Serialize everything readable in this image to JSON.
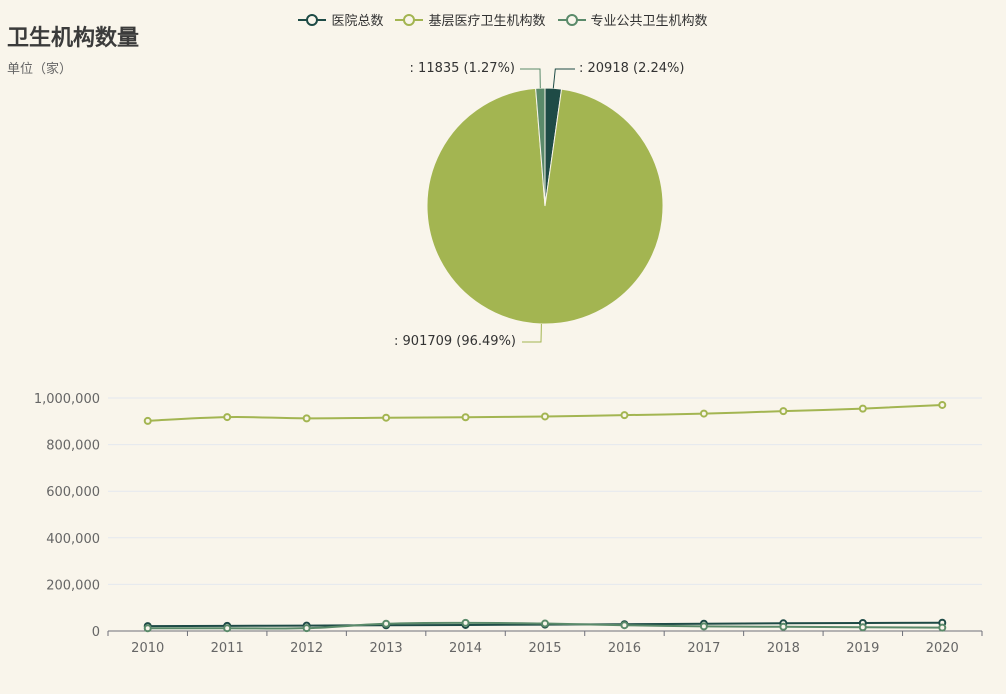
{
  "title": "卫生机构数量",
  "subtitle": "单位（家）",
  "legend": [
    {
      "name": "医院总数",
      "color": "#1e4b46"
    },
    {
      "name": "基层医疗卫生机构数",
      "color": "#a3b551"
    },
    {
      "name": "专业公共卫生机构数",
      "color": "#5a8a6a"
    }
  ],
  "chart_data": [
    {
      "type": "pie",
      "slices": [
        {
          "name": "医院总数",
          "value": 20918,
          "percent": 2.24,
          "label": ": 20918 (2.24%)",
          "color": "#1e4b46"
        },
        {
          "name": "基层医疗卫生机构数",
          "value": 901709,
          "percent": 96.49,
          "label": ": 901709 (96.49%)",
          "color": "#a3b551"
        },
        {
          "name": "专业公共卫生机构数",
          "value": 11835,
          "percent": 1.27,
          "label": ": 11835 (1.27%)",
          "color": "#5a8a6a"
        }
      ]
    },
    {
      "type": "line",
      "categories": [
        "2010",
        "2011",
        "2012",
        "2013",
        "2014",
        "2015",
        "2016",
        "2017",
        "2018",
        "2019",
        "2020"
      ],
      "ylim": [
        0,
        1000000
      ],
      "yticks": [
        0,
        200000,
        400000,
        600000,
        800000,
        1000000
      ],
      "ytick_labels": [
        "0",
        "200,000",
        "400,000",
        "600,000",
        "800,000",
        "1,000,000"
      ],
      "grid": true,
      "series": [
        {
          "name": "医院总数",
          "color": "#1e4b46",
          "values": [
            20918,
            21979,
            23170,
            24709,
            25860,
            27587,
            29140,
            31056,
            33009,
            34354,
            35394
          ]
        },
        {
          "name": "基层医疗卫生机构数",
          "color": "#a3b551",
          "values": [
            901709,
            918003,
            912620,
            915368,
            917335,
            920770,
            926518,
            933024,
            943639,
            954390,
            970036
          ]
        },
        {
          "name": "专业公共卫生机构数",
          "color": "#5a8a6a",
          "values": [
            11835,
            11926,
            12083,
            31155,
            35029,
            31927,
            24866,
            19896,
            18033,
            15958,
            14492
          ]
        }
      ]
    }
  ]
}
